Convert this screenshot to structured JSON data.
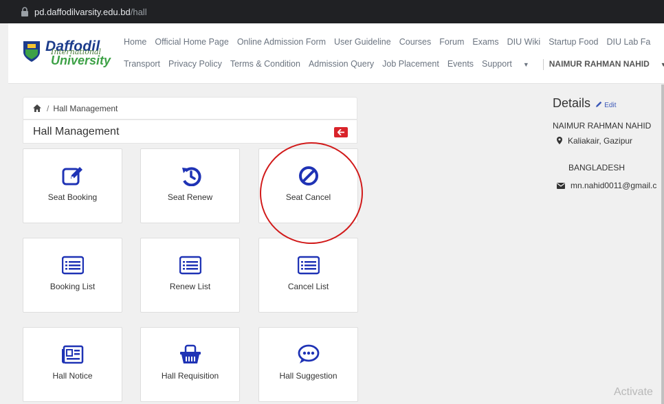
{
  "browser": {
    "url_host": "pd.daffodilvarsity.edu.bd",
    "url_path": "/hall"
  },
  "logo": {
    "line1": "Daffodil",
    "line2": "International",
    "line3": "University"
  },
  "nav_row1": [
    "Home",
    "Official Home Page",
    "Online Admission Form",
    "User Guideline",
    "Courses",
    "Forum",
    "Exams",
    "DIU Wiki",
    "Startup Food",
    "DIU Lab Fa"
  ],
  "nav_row2": [
    "Transport",
    "Privacy Policy",
    "Terms & Condition",
    "Admission Query",
    "Job Placement",
    "Events"
  ],
  "nav_support": "Support",
  "nav_user": "NAIMUR RAHMAN NAHID",
  "breadcrumb": {
    "separator": "/",
    "current": "Hall Management"
  },
  "page_title": "Hall Management",
  "cards": [
    {
      "label": "Seat Booking",
      "icon": "edit-icon"
    },
    {
      "label": "Seat Renew",
      "icon": "renew-icon"
    },
    {
      "label": "Seat Cancel",
      "icon": "ban-icon"
    },
    {
      "label": "Booking List",
      "icon": "list-icon"
    },
    {
      "label": "Renew List",
      "icon": "list-icon"
    },
    {
      "label": "Cancel List",
      "icon": "list-icon"
    },
    {
      "label": "Hall Notice",
      "icon": "newspaper-icon"
    },
    {
      "label": "Hall Requisition",
      "icon": "basket-icon"
    },
    {
      "label": "Hall Suggestion",
      "icon": "comment-icon"
    }
  ],
  "details": {
    "title": "Details",
    "edit_label": "Edit",
    "name": "NAIMUR RAHMAN NAHID",
    "address": "Kaliakair, Gazipur",
    "country": "BANGLADESH",
    "email": "mn.nahid0011@gmail.c"
  },
  "watermark": "Activate",
  "colors": {
    "accent": "#1f33b5",
    "back_button": "#d9232a",
    "annotation_circle": "#d11a1a"
  }
}
